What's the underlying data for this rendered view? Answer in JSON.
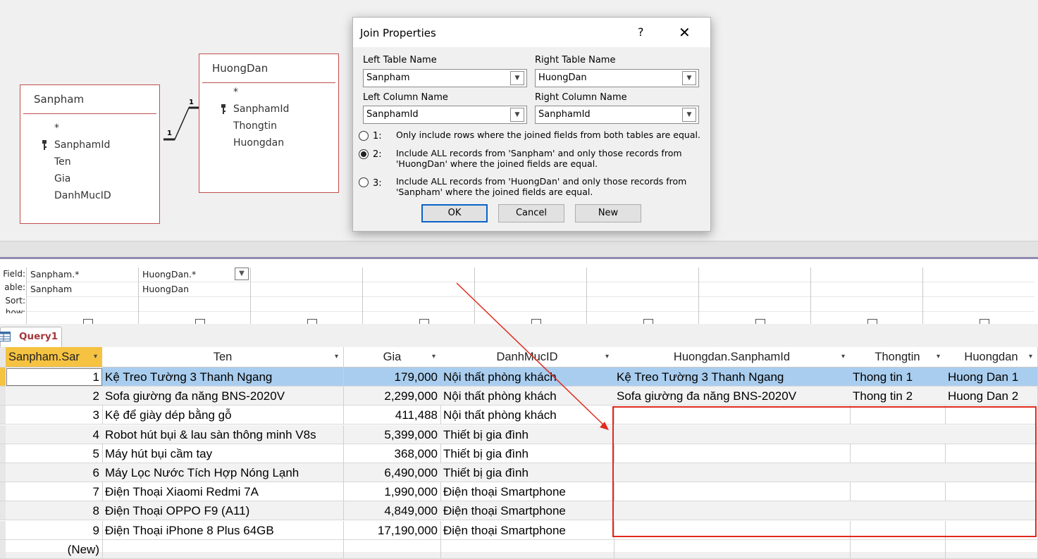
{
  "design": {
    "tables": [
      {
        "title": "Sanpham",
        "fields": [
          "*",
          "SanphamId",
          "Ten",
          "Gia",
          "DanhMucID"
        ],
        "key_field": "SanphamId"
      },
      {
        "title": "HuongDan",
        "fields": [
          "*",
          "SanphamId",
          "Thongtin",
          "Huongdan"
        ],
        "key_field": "SanphamId"
      }
    ],
    "relation_left": "1",
    "relation_right": "1"
  },
  "dialog": {
    "title": "Join Properties",
    "help": "?",
    "close": "✕",
    "left_table_label": "Left Table Name",
    "left_table_value": "Sanpham",
    "right_table_label": "Right Table Name",
    "right_table_value": "HuongDan",
    "left_column_label": "Left Column Name",
    "left_column_value": "SanphamId",
    "right_column_label": "Right Column Name",
    "right_column_value": "SanphamId",
    "options": [
      {
        "num": "1:",
        "text": "Only include rows where the joined fields from both tables are equal.",
        "selected": false
      },
      {
        "num": "2:",
        "text": "Include ALL records from 'Sanpham' and only those records from 'HuongDan' where the joined fields are equal.",
        "selected": true
      },
      {
        "num": "3:",
        "text": "Include ALL records from 'HuongDan' and only those records from 'Sanpham' where the joined fields are equal.",
        "selected": false
      }
    ],
    "ok": "OK",
    "cancel": "Cancel",
    "new": "New"
  },
  "qbe": {
    "row_labels": [
      "Field:",
      "able:",
      "Sort:",
      "how:"
    ],
    "columns": [
      {
        "field": "Sanpham.*",
        "table": "Sanpham"
      },
      {
        "field": "HuongDan.*",
        "table": "HuongDan"
      }
    ]
  },
  "tab": {
    "label": "Query1"
  },
  "datasheet": {
    "headers": [
      "Sanpham.Sar",
      "Ten",
      "Gia",
      "DanhMucID",
      "Huongdan.SanphamId",
      "Thongtin",
      "Huongdan"
    ],
    "rows": [
      [
        "1",
        "Kệ Treo Tường 3 Thanh Ngang",
        "179,000",
        "Nội thất phòng khách",
        "Kệ Treo Tường 3 Thanh Ngang",
        "Thong tin 1",
        "Huong Dan 1"
      ],
      [
        "2",
        "Sofa giường đa năng BNS-2020V",
        "2,299,000",
        "Nội thất phòng khách",
        "Sofa giường đa năng BNS-2020V",
        "Thong tin 2",
        "Huong Dan 2"
      ],
      [
        "3",
        "Kệ để giày dép bằng gỗ",
        "411,488",
        "Nội thất phòng khách",
        "",
        "",
        ""
      ],
      [
        "4",
        "Robot hút bụi & lau sàn thông minh V8s",
        "5,399,000",
        "Thiết bị gia đình",
        "",
        "",
        ""
      ],
      [
        "5",
        "Máy hút bụi cầm tay",
        "368,000",
        "Thiết bị gia đình",
        "",
        "",
        ""
      ],
      [
        "6",
        "Máy Lọc Nước Tích Hợp Nóng Lạnh",
        "6,490,000",
        "Thiết bị gia đình",
        "",
        "",
        ""
      ],
      [
        "7",
        "Điện Thoại Xiaomi Redmi 7A",
        "1,990,000",
        "Điện thoại Smartphone",
        "",
        "",
        ""
      ],
      [
        "8",
        "Điện Thoại OPPO F9 (A11)",
        "4,849,000",
        "Điện thoại Smartphone",
        "",
        "",
        ""
      ],
      [
        "9",
        "Điện Thoại iPhone 8 Plus 64GB",
        "17,190,000",
        "Điện thoại Smartphone",
        "",
        "",
        ""
      ]
    ],
    "new_row_label": "(New)"
  },
  "colors": {
    "accent_red": "#e02a1e",
    "selected_row": "#a9cdee",
    "header_selected": "#f5c241",
    "table_border": "#c0504d"
  }
}
